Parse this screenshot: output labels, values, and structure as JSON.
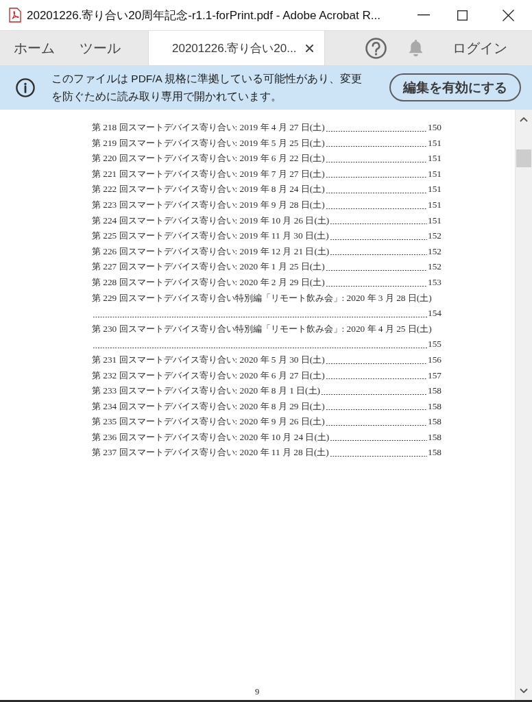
{
  "window": {
    "title": "20201226.寄り合い20周年記念-r1.1-forPrint.pdf - Adobe Acrobat R..."
  },
  "tabs": [
    {
      "kind": "nav",
      "label": "ホーム",
      "selected": false
    },
    {
      "kind": "nav",
      "label": "ツール",
      "selected": false
    },
    {
      "kind": "document",
      "label": "20201226.寄り合い20...",
      "selected": true
    }
  ],
  "toolbar": {
    "login": "ログイン"
  },
  "info_bar": {
    "message": "このファイルは PDF/A 規格に準拠している可能性があり、変更を防ぐために読み取り専用で開かれています。",
    "button": "編集を有効にする"
  },
  "document": {
    "toc": [
      {
        "title": "第 218 回スマートデバイス寄り合い: 2019 年 4 月 27 日(土)",
        "page": "150"
      },
      {
        "title": "第 219 回スマートデバイス寄り合い: 2019 年 5 月 25 日(土)",
        "page": "151"
      },
      {
        "title": "第 220 回スマートデバイス寄り合い: 2019 年 6 月 22 日(土)",
        "page": "151"
      },
      {
        "title": "第 221 回スマートデバイス寄り合い: 2019 年 7 月 27 日(土)",
        "page": "151"
      },
      {
        "title": "第 222 回スマートデバイス寄り合い: 2019 年 8 月 24 日(土)",
        "page": "151"
      },
      {
        "title": "第 223 回スマートデバイス寄り合い: 2019 年 9 月 28 日(土)",
        "page": "151"
      },
      {
        "title": "第 224 回スマートデバイス寄り合い: 2019 年 10 月 26 日(土)",
        "page": "151"
      },
      {
        "title": "第 225 回スマートデバイス寄り合い: 2019 年 11 月 30 日(土)",
        "page": "152"
      },
      {
        "title": "第 226 回スマートデバイス寄り合い: 2019 年 12 月 21 日(土)",
        "page": "152"
      },
      {
        "title": "第 227 回スマートデバイス寄り合い: 2020 年 1 月 25 日(土)",
        "page": "152"
      },
      {
        "title": "第 228 回スマートデバイス寄り合い: 2020 年 2 月 29 日(土)",
        "page": "153"
      },
      {
        "title": "第 229 回スマートデバイス寄り合い特別編「リモート飲み会」: 2020 年 3 月 28 日(土)",
        "page": "154"
      },
      {
        "title": "第 230 回スマートデバイス寄り合い特別編「リモート飲み会」: 2020 年 4 月 25 日(土)",
        "page": "155"
      },
      {
        "title": "第 231 回スマートデバイス寄り合い: 2020 年 5 月 30 日(土)",
        "page": "156"
      },
      {
        "title": "第 232 回スマートデバイス寄り合い: 2020 年 6 月 27 日(土)",
        "page": "157"
      },
      {
        "title": "第 233 回スマートデバイス寄り合い: 2020 年 8 月 1 日(土)",
        "page": "158"
      },
      {
        "title": "第 234 回スマートデバイス寄り合い: 2020 年 8 月 29 日(土)",
        "page": "158"
      },
      {
        "title": "第 235 回スマートデバイス寄り合い: 2020 年 9 月 26 日(土)",
        "page": "158"
      },
      {
        "title": "第 236 回スマートデバイス寄り合い: 2020 年 10 月 24 日(土)",
        "page": "158"
      },
      {
        "title": "第 237 回スマートデバイス寄り合い: 2020 年 11 月 28 日(土)",
        "page": "158"
      }
    ],
    "page_number": "9"
  }
}
